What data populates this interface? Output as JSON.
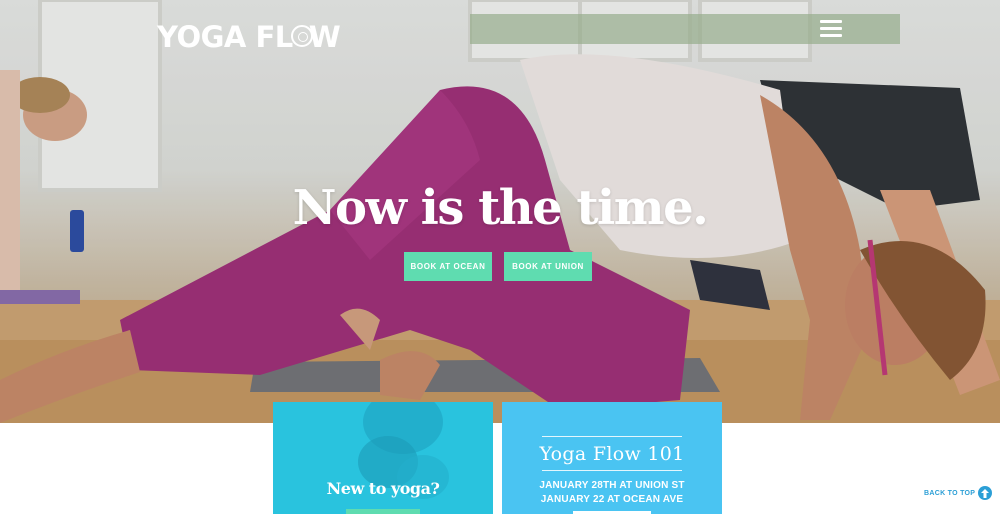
{
  "header": {
    "logo_text_left": "YOGA FL",
    "logo_text_right": "W",
    "logo_seal_text": "SF",
    "menu_icon": "hamburger-menu-icon"
  },
  "hero": {
    "headline": "Now is the time.",
    "buttons": [
      {
        "label": "BOOK AT OCEAN"
      },
      {
        "label": "BOOK AT UNION"
      }
    ]
  },
  "cards": {
    "new_to_yoga": {
      "title": "New to yoga?"
    },
    "yoga_flow_101": {
      "title": "Yoga Flow 101",
      "dates": [
        "JANUARY 28TH AT UNION ST",
        "JANUARY 22 AT OCEAN AVE"
      ]
    }
  },
  "footer": {
    "back_to_top": "BACK TO TOP",
    "back_to_top_icon": "arrow-up-circle-icon"
  },
  "colors": {
    "accent_green": "#5fdcb0",
    "card_cyan": "#29c3de",
    "card_blue": "#4ac4f2",
    "link_blue": "#2c9fd6",
    "leggings_magenta": "#a0307a"
  }
}
